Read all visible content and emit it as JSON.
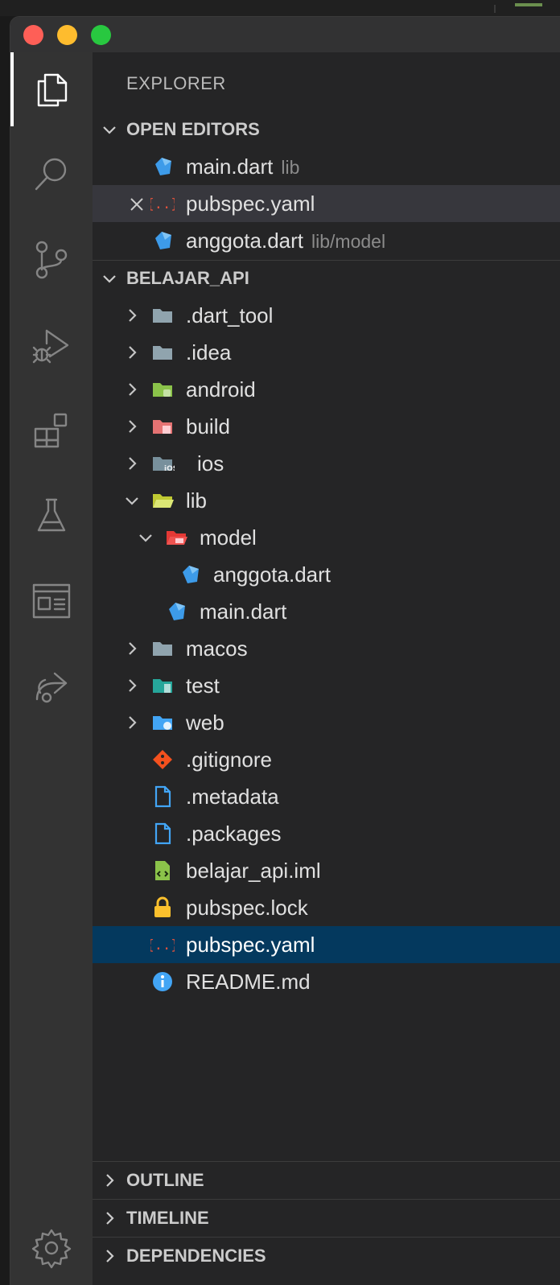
{
  "explorer": {
    "title": "EXPLORER"
  },
  "open_editors": {
    "header": "OPEN EDITORS",
    "items": [
      {
        "name": "main.dart",
        "desc": "lib",
        "icon": "dart-icon"
      },
      {
        "name": "pubspec.yaml",
        "desc": "",
        "icon": "yaml-icon"
      },
      {
        "name": "anggota.dart",
        "desc": "lib/model",
        "icon": "dart-icon"
      }
    ]
  },
  "project": {
    "header": "BELAJAR_API",
    "items": [
      {
        "name": ".dart_tool",
        "icon": "folder-icon"
      },
      {
        "name": ".idea",
        "icon": "folder-icon"
      },
      {
        "name": "android",
        "icon": "android-folder-icon"
      },
      {
        "name": "build",
        "icon": "build-folder-icon"
      },
      {
        "name": "ios",
        "icon": "ios-folder-icon"
      },
      {
        "name": "lib",
        "icon": "lib-folder-open-icon"
      },
      {
        "name": "model",
        "icon": "model-folder-open-icon"
      },
      {
        "name": "anggota.dart",
        "icon": "dart-icon"
      },
      {
        "name": "main.dart",
        "icon": "dart-icon"
      },
      {
        "name": "macos",
        "icon": "folder-icon"
      },
      {
        "name": "test",
        "icon": "test-folder-icon"
      },
      {
        "name": "web",
        "icon": "web-folder-icon"
      },
      {
        "name": ".gitignore",
        "icon": "git-icon"
      },
      {
        "name": ".metadata",
        "icon": "file-icon"
      },
      {
        "name": ".packages",
        "icon": "file-icon"
      },
      {
        "name": "belajar_api.iml",
        "icon": "iml-icon"
      },
      {
        "name": "pubspec.lock",
        "icon": "lock-icon"
      },
      {
        "name": "pubspec.yaml",
        "icon": "yaml-icon"
      },
      {
        "name": "README.md",
        "icon": "info-icon"
      }
    ]
  },
  "bottom_sections": [
    "OUTLINE",
    "TIMELINE",
    "DEPENDENCIES"
  ],
  "colors": {
    "selected_bg": "#04395e",
    "hover_bg": "#37373d",
    "dart_blue": "#3d9be9",
    "yaml_red": "#e5533d"
  }
}
